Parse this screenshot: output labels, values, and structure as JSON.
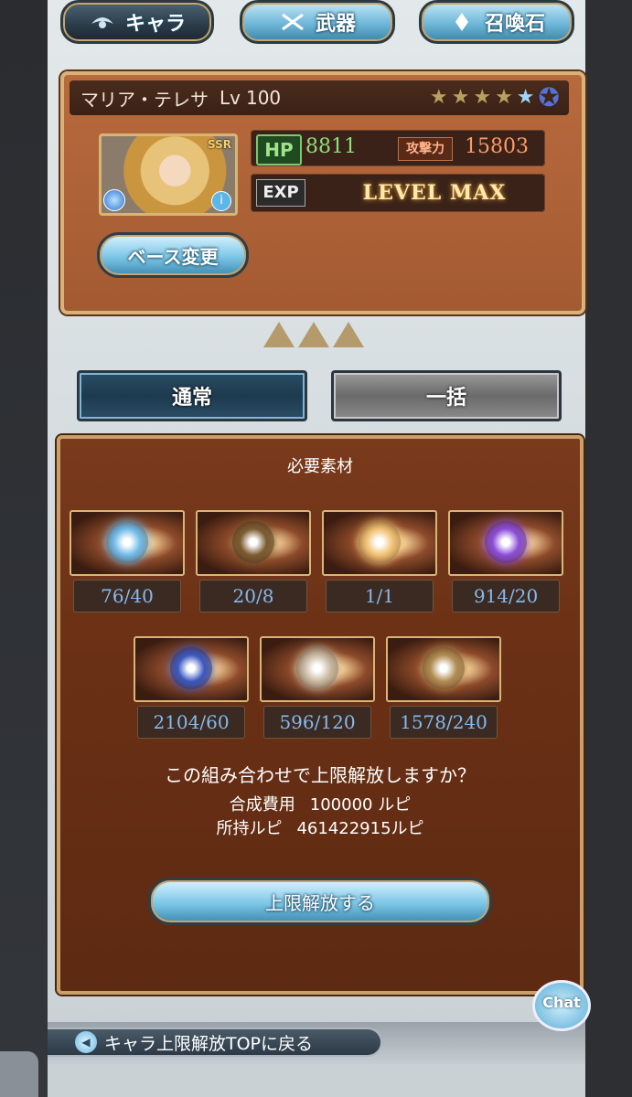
{
  "top_tabs": {
    "chara": "キャラ",
    "weapon": "武器",
    "summon": "召喚石"
  },
  "character": {
    "name": "マリア・テレサ",
    "level_label": "Lv",
    "level": "100",
    "rarity": "SSR",
    "stars_filled": 4,
    "stars_total": 5,
    "hp_label": "HP",
    "hp": "8811",
    "atk_label": "攻撃力",
    "atk": "15803",
    "exp_label": "EXP",
    "exp_status": "LEVEL MAX",
    "base_change_button": "ベース変更"
  },
  "modes": {
    "normal": "通常",
    "bulk": "一括"
  },
  "materials": {
    "title": "必要素材",
    "items": [
      {
        "count": "76/40",
        "color": "#6fb9e8"
      },
      {
        "count": "20/8",
        "color": "#7a5a30"
      },
      {
        "count": "1/1",
        "color": "#f0c070"
      },
      {
        "count": "914/20",
        "color": "#8a4ad8"
      },
      {
        "count": "2104/60",
        "color": "#3a56c0"
      },
      {
        "count": "596/120",
        "color": "#c8b8a0"
      },
      {
        "count": "1578/240",
        "color": "#b08a50"
      }
    ]
  },
  "confirm": {
    "question": "この組み合わせで上限解放しますか？",
    "cost_label": "合成費用",
    "cost_value": "100000 ルピ",
    "owned_label": "所持ルピ",
    "owned_value": "461422915ルピ",
    "button": "上限解放する"
  },
  "chat_label": "Chat",
  "back_label": "キャラ上限解放TOPに戻る"
}
